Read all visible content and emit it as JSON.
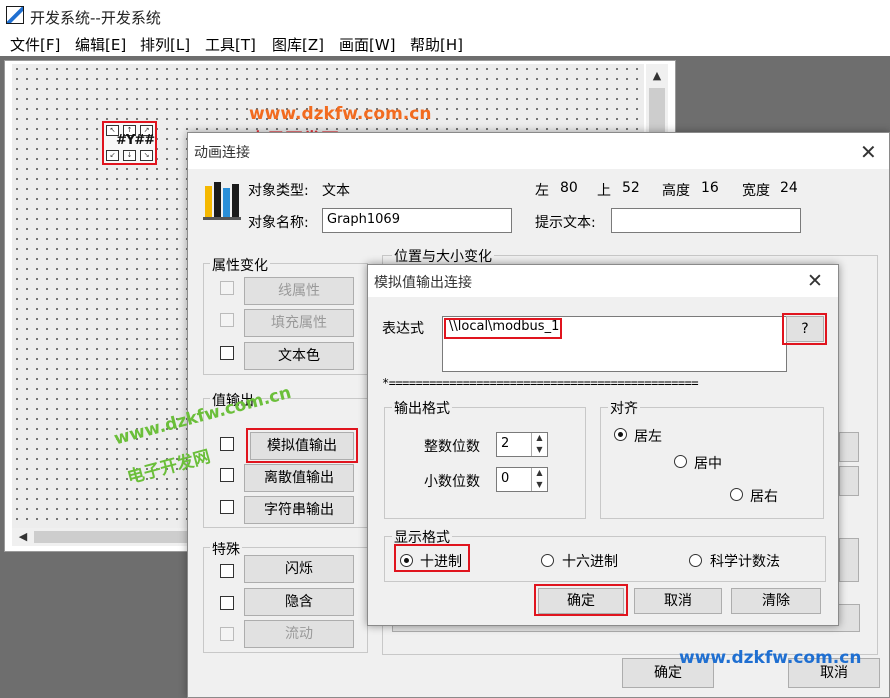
{
  "app": {
    "title": "开发系统--开发系统"
  },
  "menu": [
    "文件[F]",
    "编辑[E]",
    "排列[L]",
    "工具[T]",
    "图库[Z]",
    "画面[W]",
    "帮助[H]"
  ],
  "graph_object": {
    "text": "#Y##"
  },
  "watermarks": {
    "url": "www.dzkfw.com.cn",
    "cn": "电子开发网"
  },
  "animation_dialog": {
    "title": "动画连接",
    "object_type_label": "对象类型:",
    "object_type_value": "文本",
    "left_label": "左",
    "left_value": "80",
    "top_label": "上",
    "top_value": "52",
    "height_label": "高度",
    "height_value": "16",
    "width_label": "宽度",
    "width_value": "24",
    "object_name_label": "对象名称:",
    "object_name_value": "Graph1069",
    "hint_label": "提示文本:",
    "hint_value": "",
    "property_group": "属性变化",
    "line_attr": "线属性",
    "fill_attr": "填充属性",
    "text_color": "文本色",
    "value_output_group": "值输出",
    "analog_output": "模拟值输出",
    "discrete_output": "离散值输出",
    "string_output": "字符串输出",
    "special_group": "特殊",
    "blink": "闪烁",
    "hide": "隐含",
    "flow": "流动",
    "position_group": "位置与大小变化",
    "ok": "确定",
    "cancel": "取消"
  },
  "analog_dialog": {
    "title": "模拟值输出连接",
    "expression_label": "表达式",
    "expression_value": "\\\\local\\modbus_1",
    "help_button": "?",
    "separator": "*==============================================",
    "output_format_group": "输出格式",
    "integer_digits_label": "整数位数",
    "integer_digits_value": "2",
    "decimal_digits_label": "小数位数",
    "decimal_digits_value": "0",
    "align_group": "对齐",
    "align_left": "居左",
    "align_center": "居中",
    "align_right": "居右",
    "display_format_group": "显示格式",
    "decimal": "十进制",
    "hex": "十六进制",
    "scientific": "科学计数法",
    "ok": "确定",
    "cancel": "取消",
    "clear": "清除"
  },
  "colors": {
    "highlight": "#e0141e",
    "watermark_orange": "#f26b1f",
    "watermark_green": "#6bbf3a",
    "watermark_blue": "#1f6fd1"
  }
}
